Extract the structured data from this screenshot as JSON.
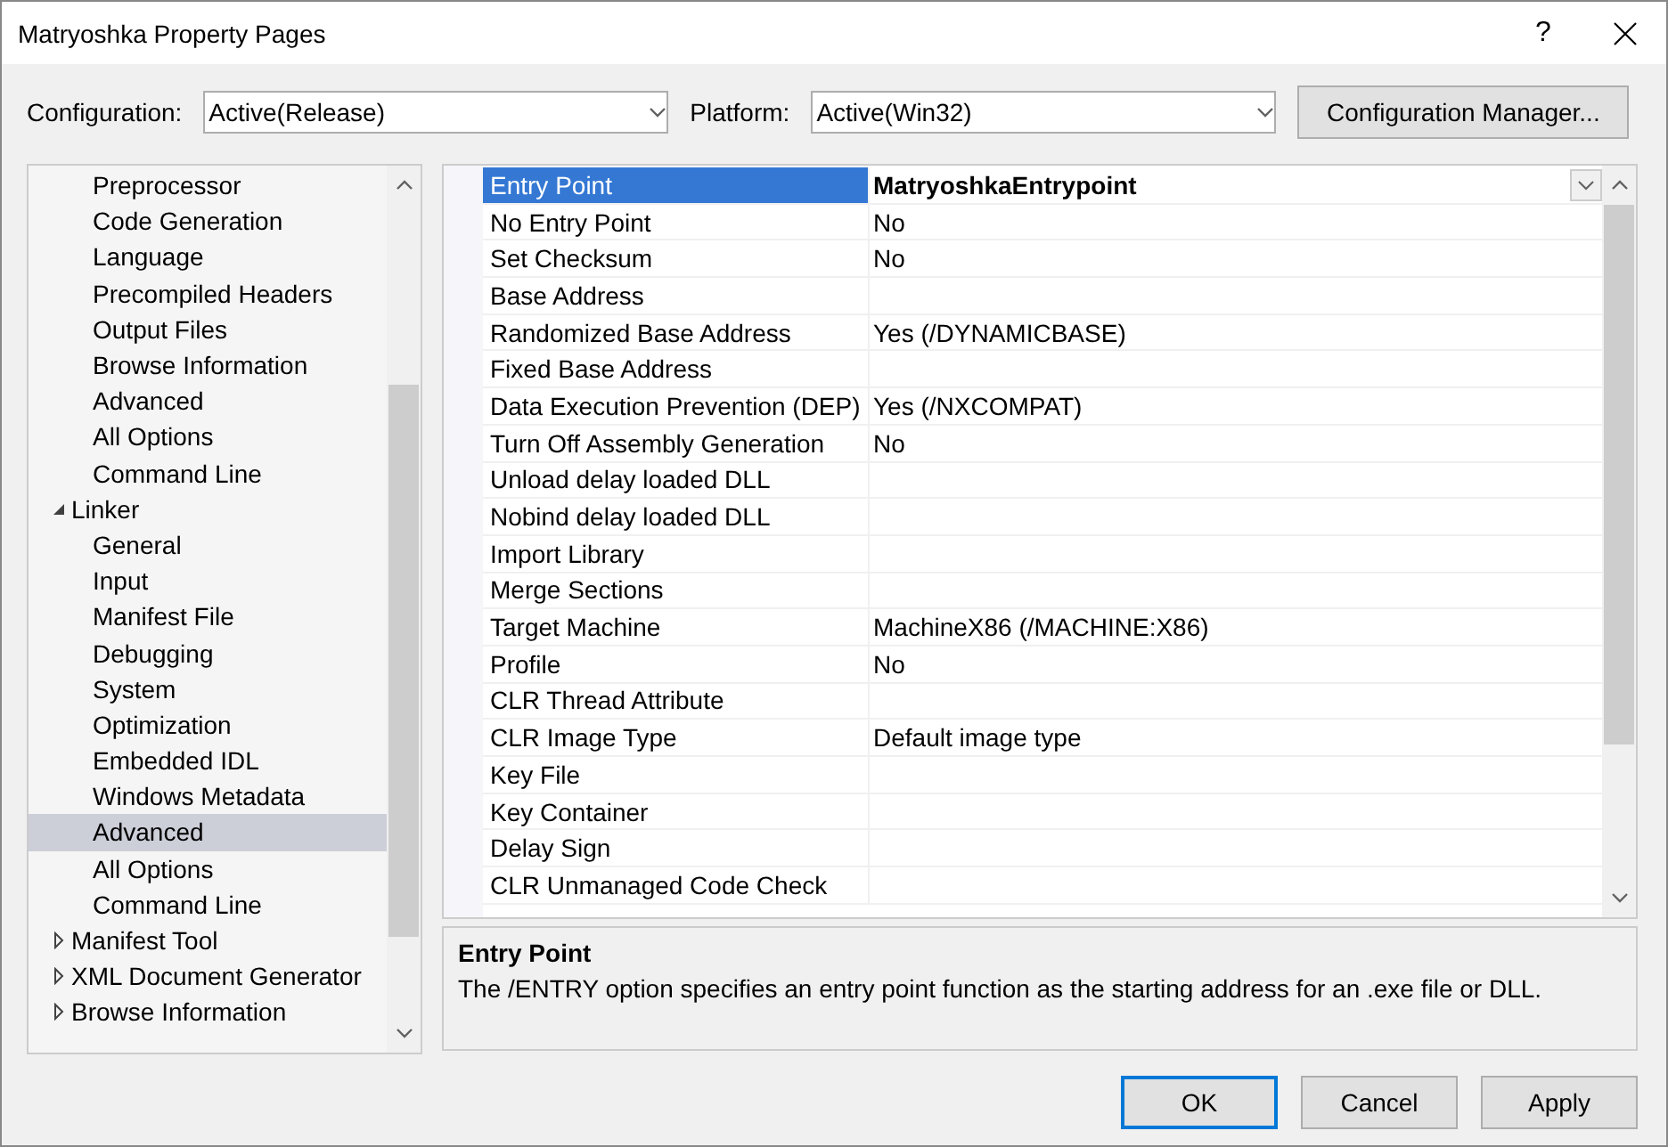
{
  "window": {
    "title": "Matryoshka Property Pages",
    "help": "?"
  },
  "config_bar": {
    "configuration_label": "Configuration:",
    "configuration": "Active(Release)",
    "platform_label": "Platform:",
    "platform": "Active(Win32)",
    "manager_button": "Configuration Manager..."
  },
  "tree": [
    {
      "children": [
        {
          "label": "Preprocessor",
          "selected": false
        },
        {
          "label": "Code Generation",
          "selected": false
        },
        {
          "label": "Language",
          "selected": false
        },
        {
          "label": "Precompiled Headers",
          "selected": false
        },
        {
          "label": "Output Files",
          "selected": false
        },
        {
          "label": "Browse Information",
          "selected": false
        },
        {
          "label": "Advanced",
          "selected": false
        },
        {
          "label": "All Options",
          "selected": false
        },
        {
          "label": "Command Line",
          "selected": false
        }
      ]
    },
    {
      "label": "Linker",
      "expanded": true,
      "selected": false,
      "children": [
        {
          "label": "General",
          "selected": false
        },
        {
          "label": "Input",
          "selected": false
        },
        {
          "label": "Manifest File",
          "selected": false
        },
        {
          "label": "Debugging",
          "selected": false
        },
        {
          "label": "System",
          "selected": false
        },
        {
          "label": "Optimization",
          "selected": false
        },
        {
          "label": "Embedded IDL",
          "selected": false
        },
        {
          "label": "Windows Metadata",
          "selected": false
        },
        {
          "label": "Advanced",
          "selected": true
        },
        {
          "label": "All Options",
          "selected": false
        },
        {
          "label": "Command Line",
          "selected": false
        }
      ]
    },
    {
      "label": "Manifest Tool",
      "expanded": false,
      "selected": false
    },
    {
      "label": "XML Document Generator",
      "expanded": false,
      "selected": false
    },
    {
      "label": "Browse Information",
      "expanded": false,
      "selected": false
    }
  ],
  "properties": [
    {
      "name": "Entry Point",
      "value": "MatryoshkaEntrypoint",
      "selected": true,
      "modified": true
    },
    {
      "name": "No Entry Point",
      "value": "No",
      "selected": false,
      "modified": false
    },
    {
      "name": "Set Checksum",
      "value": "No",
      "selected": false,
      "modified": false
    },
    {
      "name": "Base Address",
      "selected": false
    },
    {
      "name": "Randomized Base Address",
      "value": "Yes (/DYNAMICBASE)",
      "selected": false,
      "modified": false
    },
    {
      "name": "Fixed Base Address",
      "selected": false
    },
    {
      "name": "Data Execution Prevention (DEP)",
      "value": "Yes (/NXCOMPAT)",
      "selected": false,
      "modified": false
    },
    {
      "name": "Turn Off Assembly Generation",
      "value": "No",
      "selected": false,
      "modified": false
    },
    {
      "name": "Unload delay loaded DLL",
      "selected": false
    },
    {
      "name": "Nobind delay loaded DLL",
      "selected": false
    },
    {
      "name": "Import Library",
      "selected": false
    },
    {
      "name": "Merge Sections",
      "selected": false
    },
    {
      "name": "Target Machine",
      "value": "MachineX86 (/MACHINE:X86)",
      "selected": false,
      "modified": false
    },
    {
      "name": "Profile",
      "value": "No",
      "selected": false,
      "modified": false
    },
    {
      "name": "CLR Thread Attribute",
      "selected": false
    },
    {
      "name": "CLR Image Type",
      "value": "Default image type",
      "selected": false,
      "modified": false
    },
    {
      "name": "Key File",
      "selected": false
    },
    {
      "name": "Key Container",
      "selected": false
    },
    {
      "name": "Delay Sign",
      "selected": false
    },
    {
      "name": "CLR Unmanaged Code Check",
      "selected": false
    }
  ],
  "description": {
    "title": "Entry Point",
    "text": "The /ENTRY option specifies an entry point function as the starting address for an .exe file or DLL."
  },
  "buttons": [
    {
      "label": "OK",
      "default": true
    },
    {
      "label": "Cancel",
      "default": false
    },
    {
      "label": "Apply",
      "default": false
    }
  ]
}
